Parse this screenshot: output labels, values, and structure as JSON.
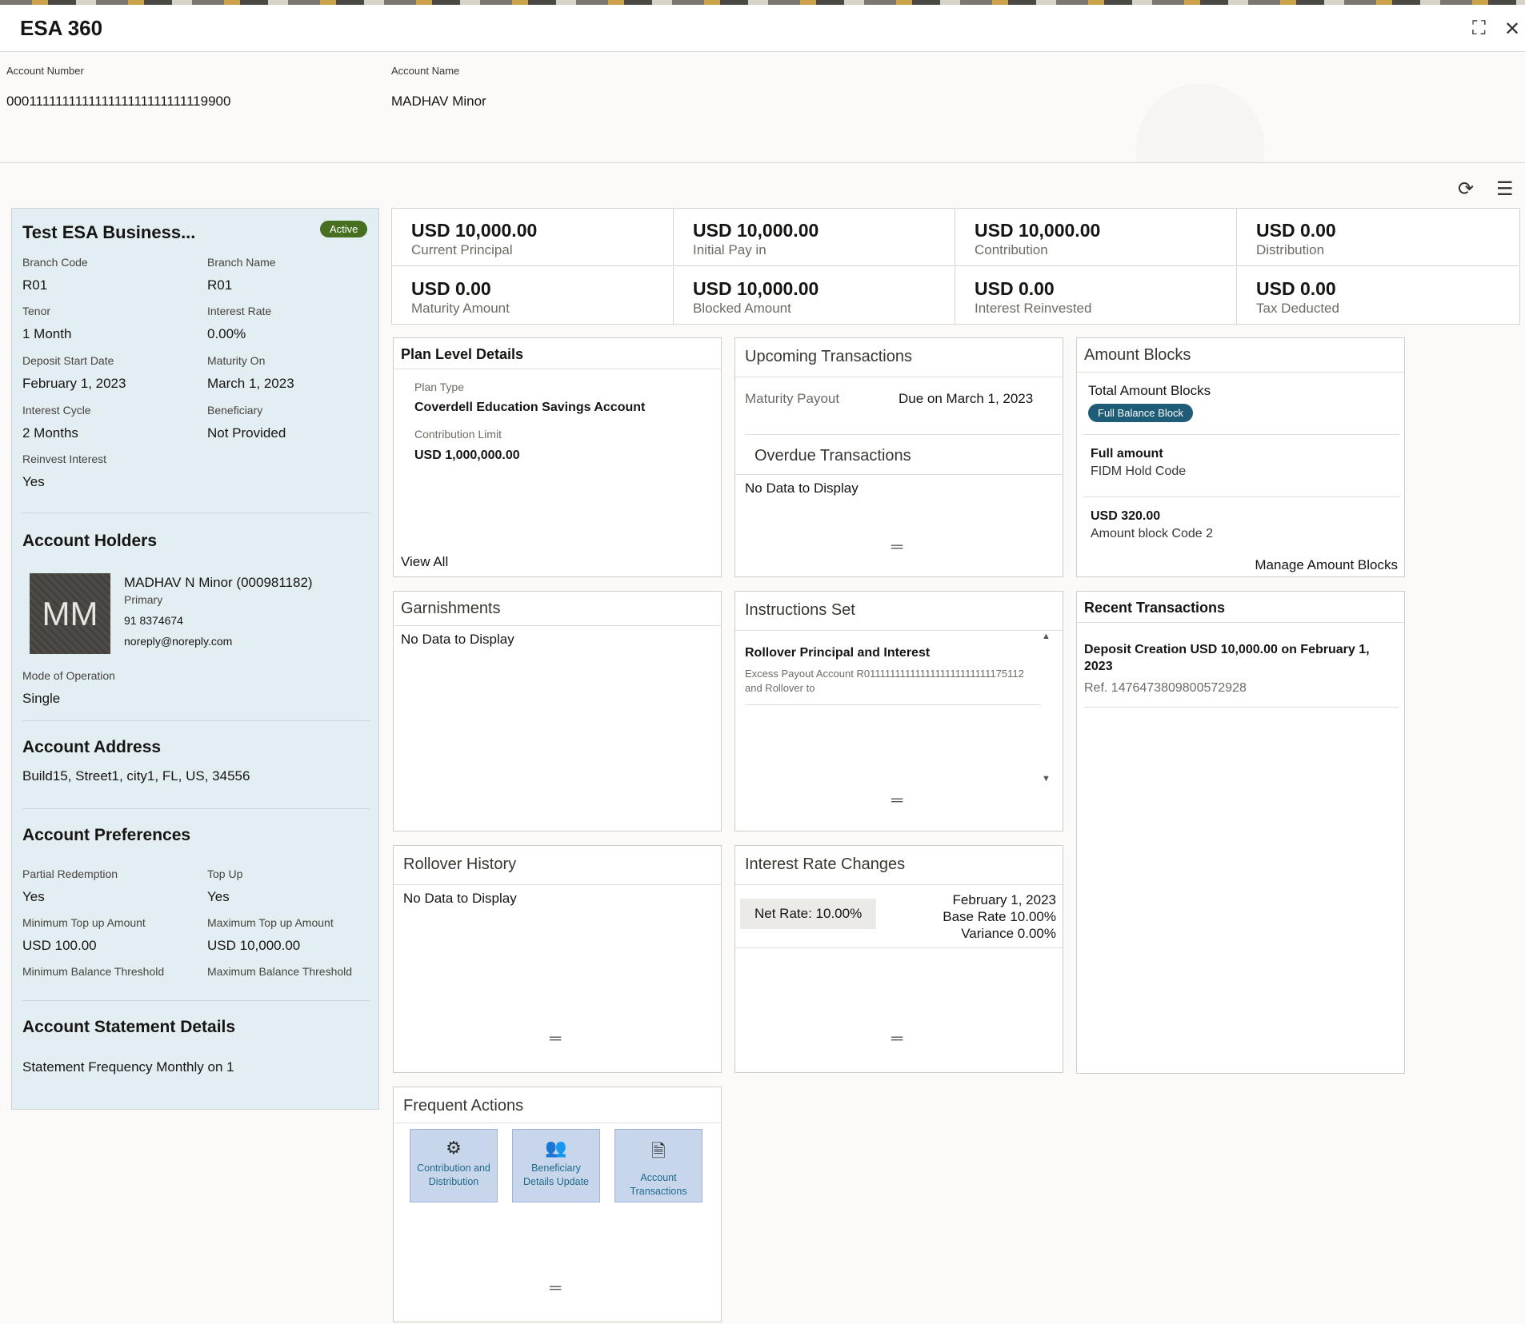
{
  "window": {
    "title": "ESA 360",
    "minimize_icon": "collapse-icon",
    "close_icon": "close-icon"
  },
  "account": {
    "number_label": "Account Number",
    "number": "000111111111111111111111111119900",
    "name_label": "Account Name",
    "name": "MADHAV Minor"
  },
  "toolbar": {
    "refresh_icon": "refresh-icon",
    "menu_icon": "hamburger-menu-icon"
  },
  "summary": {
    "title": "Test ESA Business...",
    "status": "Active",
    "fields": [
      {
        "label": "Branch Code",
        "value": "R01"
      },
      {
        "label": "Branch Name",
        "value": "R01"
      },
      {
        "label": "Tenor",
        "value": "1 Month"
      },
      {
        "label": "Interest Rate",
        "value": "0.00%"
      },
      {
        "label": "Deposit Start Date",
        "value": "February 1, 2023"
      },
      {
        "label": "Maturity On",
        "value": "March 1, 2023"
      },
      {
        "label": "Interest Cycle",
        "value": "2 Months"
      },
      {
        "label": "Beneficiary",
        "value": "Not Provided"
      },
      {
        "label": "Reinvest Interest",
        "value": "Yes"
      }
    ],
    "holders_heading": "Account Holders",
    "holder": {
      "initials": "MM",
      "name": "MADHAV N Minor (000981182)",
      "role": "Primary",
      "phone": "91 8374674",
      "email": "noreply@noreply.com"
    },
    "mode_label": "Mode of Operation",
    "mode_value": "Single",
    "address_heading": "Account Address",
    "address": "Build15, Street1, city1, FL, US, 34556",
    "preferences_heading": "Account Preferences",
    "preferences": [
      {
        "label": "Partial Redemption",
        "value": "Yes"
      },
      {
        "label": "Top Up",
        "value": "Yes"
      },
      {
        "label": "Minimum Top up Amount",
        "value": "USD 100.00"
      },
      {
        "label": "Maximum Top up Amount",
        "value": "USD 10,000.00"
      },
      {
        "label": "Minimum Balance Threshold",
        "value": ""
      },
      {
        "label": "Maximum Balance Threshold",
        "value": ""
      }
    ],
    "statement_heading": "Account Statement Details",
    "statement": "Statement Frequency Monthly on 1"
  },
  "kpis": [
    {
      "value": "USD 10,000.00",
      "label": "Current Principal"
    },
    {
      "value": "USD 10,000.00",
      "label": "Initial Pay in"
    },
    {
      "value": "USD 10,000.00",
      "label": "Contribution"
    },
    {
      "value": "USD 0.00",
      "label": "Distribution"
    },
    {
      "value": "USD 0.00",
      "label": "Maturity Amount"
    },
    {
      "value": "USD 10,000.00",
      "label": "Blocked Amount"
    },
    {
      "value": "USD 0.00",
      "label": "Interest Reinvested"
    },
    {
      "value": "USD 0.00",
      "label": "Tax Deducted"
    }
  ],
  "plan": {
    "title": "Plan Level Details",
    "type_label": "Plan Type",
    "type_value": "Coverdell Education Savings Account",
    "limit_label": "Contribution Limit",
    "limit_value": "USD 1,000,000.00",
    "view_all": "View All"
  },
  "upcoming": {
    "title": "Upcoming Transactions",
    "item_label": "Maturity Payout",
    "item_value": "Due on March 1, 2023",
    "overdue_title": "Overdue Transactions",
    "overdue_empty": "No Data to Display"
  },
  "blocks": {
    "title": "Amount Blocks",
    "total_label": "Total Amount Blocks",
    "badge": "Full Balance Block",
    "items": [
      {
        "amount": "Full amount",
        "desc": "FIDM Hold Code"
      },
      {
        "amount": "USD 320.00",
        "desc": "Amount block Code 2"
      }
    ],
    "manage": "Manage Amount Blocks"
  },
  "garnishments": {
    "title": "Garnishments",
    "empty": "No Data to Display"
  },
  "instructions": {
    "title": "Instructions Set",
    "item_title": "Rollover Principal and Interest",
    "item_desc1": "Excess Payout Account R0111111111111111111111111175112",
    "item_desc2": "and Rollover to"
  },
  "recent": {
    "title": "Recent Transactions",
    "item_line1": "Deposit Creation USD 10,000.00 on February 1,",
    "item_line2": "2023",
    "item_ref": "Ref. 1476473809800572928"
  },
  "rollover": {
    "title": "Rollover History",
    "empty": "No Data to Display"
  },
  "rates": {
    "title": "Interest Rate Changes",
    "net": "Net Rate: 10.00%",
    "date": "February 1, 2023",
    "base": "Base Rate 10.00%",
    "variance": "Variance 0.00%"
  },
  "actions": {
    "title": "Frequent Actions",
    "items": [
      {
        "line1": "Contribution and",
        "line2": "Distribution",
        "icon": "contribution-icon"
      },
      {
        "line1": "Beneficiary",
        "line2": "Details Update",
        "icon": "beneficiary-icon"
      },
      {
        "line1": "Account",
        "line2": "Transactions",
        "icon": "transactions-icon"
      }
    ]
  },
  "grip_glyph": "═"
}
